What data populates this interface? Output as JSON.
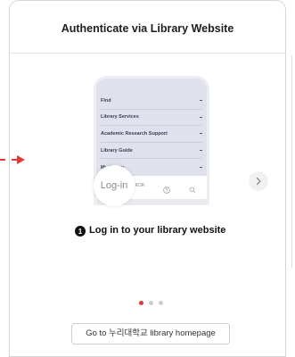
{
  "header": {
    "title": "Authenticate via Library Website"
  },
  "phone": {
    "menu_items": [
      {
        "label": "Find"
      },
      {
        "label": "Library Services"
      },
      {
        "label": "Academic Research Support"
      },
      {
        "label": "Library Guide"
      },
      {
        "label": "My library"
      }
    ],
    "bottom_bar": {
      "login_label": "Log-in",
      "lang_label": "KOR"
    }
  },
  "step": {
    "number": "1",
    "text": "Log in to your library website"
  },
  "pagination": {
    "total": 3,
    "active_index": 0
  },
  "cta": {
    "label": "Go to 누리대학교 library homepage"
  },
  "icons": {
    "pointer": "arrow-right-icon",
    "menu_expand": "expand-icon",
    "help": "help-circle-icon",
    "search": "search-icon",
    "next": "chevron-right-icon"
  },
  "colors": {
    "accent": "#e53935",
    "phone_screen": "#dfe2ec",
    "dot_inactive": "#cccccc"
  }
}
